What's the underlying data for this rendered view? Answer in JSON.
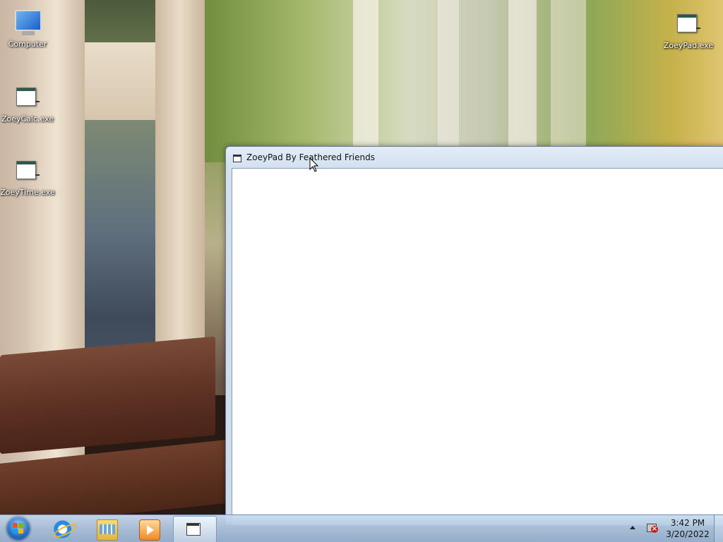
{
  "desktop": {
    "icons": {
      "computer": {
        "label": "Computer",
        "icon": "computer-icon"
      },
      "zoeycalc": {
        "label": "ZoeyCalc.exe",
        "icon": "application-icon"
      },
      "zoeytime": {
        "label": "ZoeyTime.exe",
        "icon": "application-icon"
      },
      "zoeypad": {
        "label": "ZoeyPad.exe",
        "icon": "application-icon"
      }
    }
  },
  "window": {
    "title": "ZoeyPad By Feathered Friends",
    "icon": "application-icon",
    "content_text": ""
  },
  "taskbar": {
    "start_icon": "windows-start-orb",
    "pinned": [
      {
        "name": "Internet Explorer",
        "icon": "internet-explorer-icon"
      },
      {
        "name": "Windows Explorer",
        "icon": "folder-icon"
      },
      {
        "name": "Windows Media Player",
        "icon": "media-player-icon"
      }
    ],
    "active_task": {
      "name": "ZoeyPad By Feathered Friends",
      "icon": "application-icon"
    },
    "tray": {
      "show_hidden_icon": "chevron-up-icon",
      "network_icon": "network-disconnected-icon"
    },
    "clock": {
      "time": "3:42 PM",
      "date": "3/20/2022"
    }
  },
  "colors": {
    "taskbar": "#a9c2de",
    "window_frame": "#d3e0ef",
    "start_orb": "#2b6fc0",
    "network_error": "#d21a1a"
  }
}
